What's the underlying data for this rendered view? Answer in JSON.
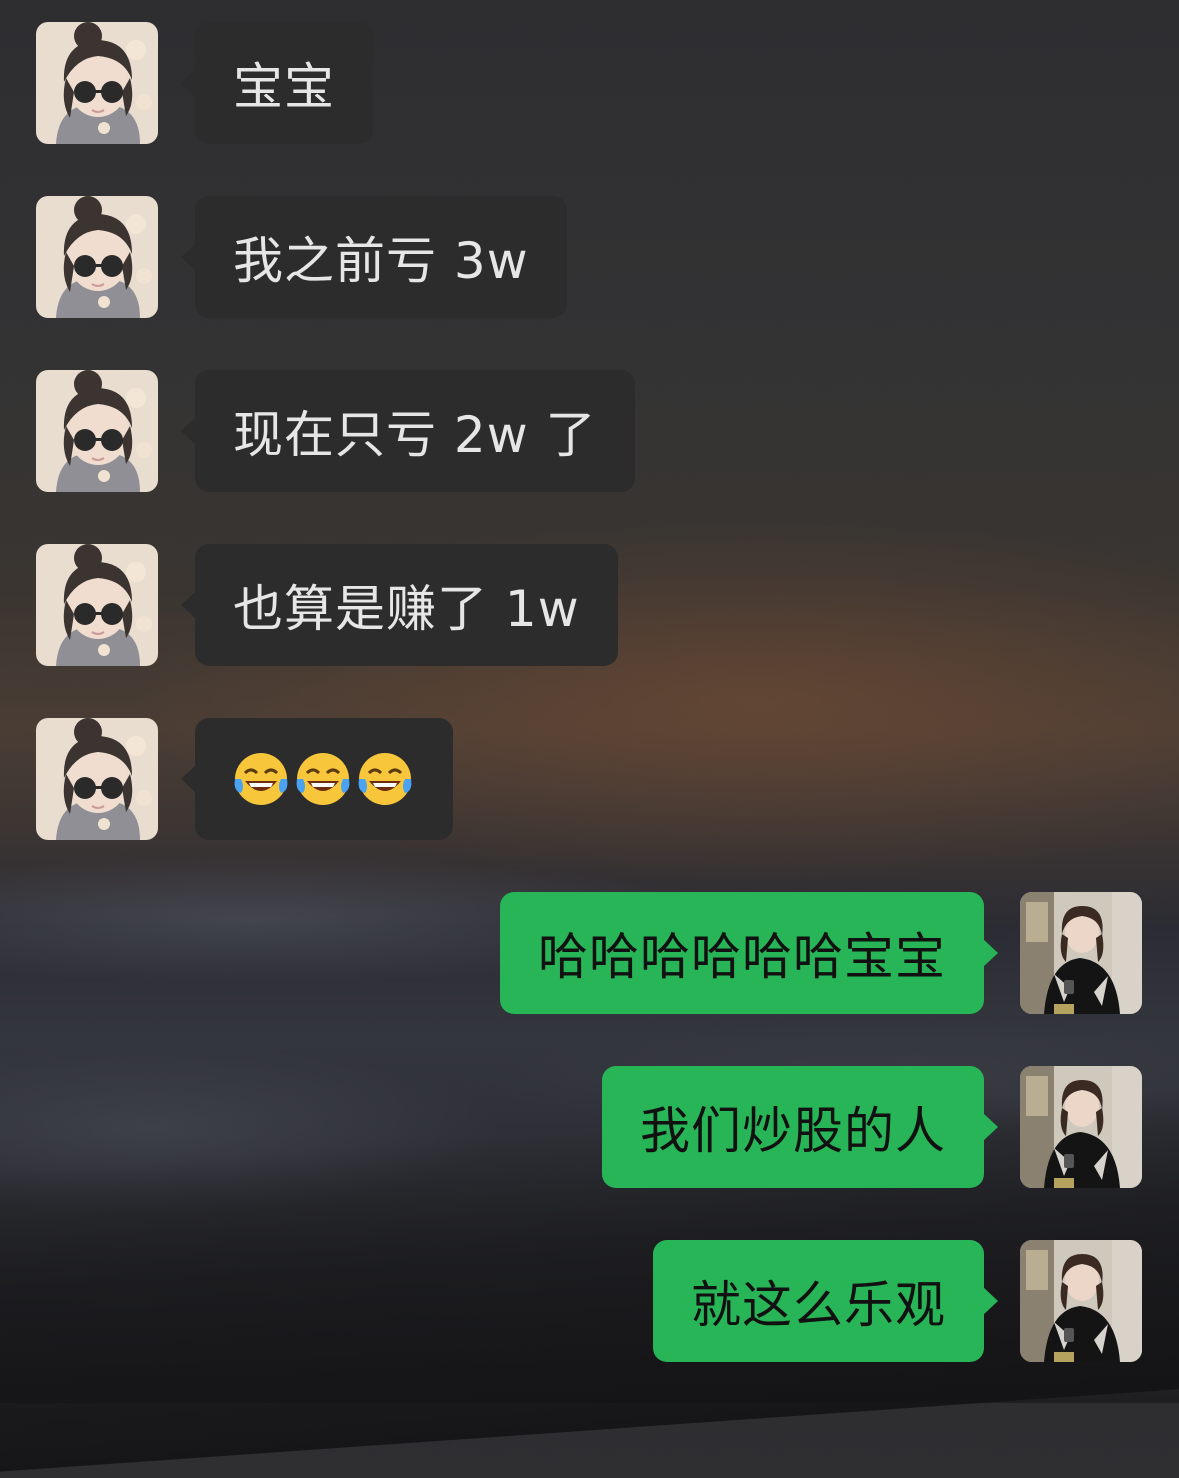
{
  "messages": [
    {
      "side": "left",
      "text": "宝宝"
    },
    {
      "side": "left",
      "text": "我之前亏 3w"
    },
    {
      "side": "left",
      "text": "现在只亏 2w 了"
    },
    {
      "side": "left",
      "text": "也算是赚了 1w"
    },
    {
      "side": "left",
      "emoji": [
        "tears-of-joy-emoji",
        "tears-of-joy-emoji",
        "tears-of-joy-emoji"
      ]
    },
    {
      "side": "right",
      "text": "哈哈哈哈哈哈宝宝"
    },
    {
      "side": "right",
      "text": "我们炒股的人"
    },
    {
      "side": "right",
      "text": "就这么乐观"
    }
  ],
  "colors": {
    "incoming_bubble": "#2c2c2c",
    "outgoing_bubble": "#28b558",
    "incoming_text": "#e6e6e6",
    "outgoing_text": "#111111"
  }
}
